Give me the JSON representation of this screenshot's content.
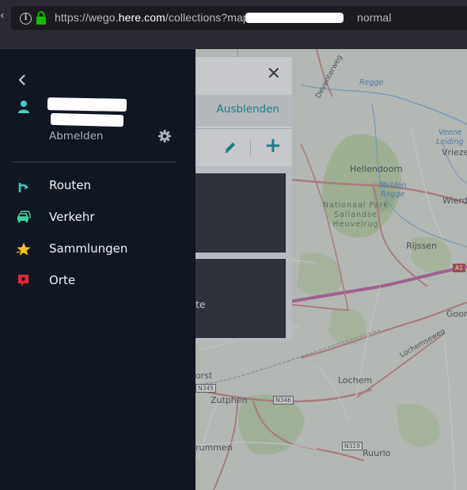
{
  "browser": {
    "url_prefix": "https://wego.",
    "url_host": "here.com",
    "url_path": "/collections?map=",
    "url_suffix": "normal"
  },
  "sidebar": {
    "signout_label": "Abmelden",
    "items": [
      {
        "label": "Routen",
        "icon": "route-icon"
      },
      {
        "label": "Verkehr",
        "icon": "traffic-car-icon"
      },
      {
        "label": "Sammlungen",
        "icon": "star-icon"
      },
      {
        "label": "Orte",
        "icon": "place-pin-icon"
      }
    ]
  },
  "panel": {
    "hide_label": "Ausblenden",
    "card_2_text": "te"
  },
  "map": {
    "labels": {
      "deventerweg": "Deventerweg",
      "regge_1": "Regge",
      "veene_leiding_1": "Veene",
      "veene_leiding_2": "Leiding",
      "vriezenveen": "Vrieze",
      "hellendoorn": "Hellendoorn",
      "midden_regge_1": "Midden",
      "midden_regge_2": "Regge",
      "wierden": "Wierd",
      "park_1": "Nationaal Park",
      "park_2": "Sallandse",
      "park_3": "Heuvelrug",
      "rijssen": "Rijssen",
      "a1": "A1",
      "goor": "Goor",
      "lochemseweg": "Lochemseweg",
      "lochem": "Lochem",
      "voorst": "orst",
      "n345": "N345",
      "zutphen": "Zutphen",
      "n346": "N346",
      "n319": "N319",
      "ruurlo": "Ruurlo",
      "brummen": "rummen"
    }
  },
  "colors": {
    "sidebar_bg": "#111722",
    "accent_teal": "#1a7f86",
    "traffic_green": "#3ecf9b",
    "collections_yellow": "#f5c518",
    "places_red": "#e2243a"
  }
}
